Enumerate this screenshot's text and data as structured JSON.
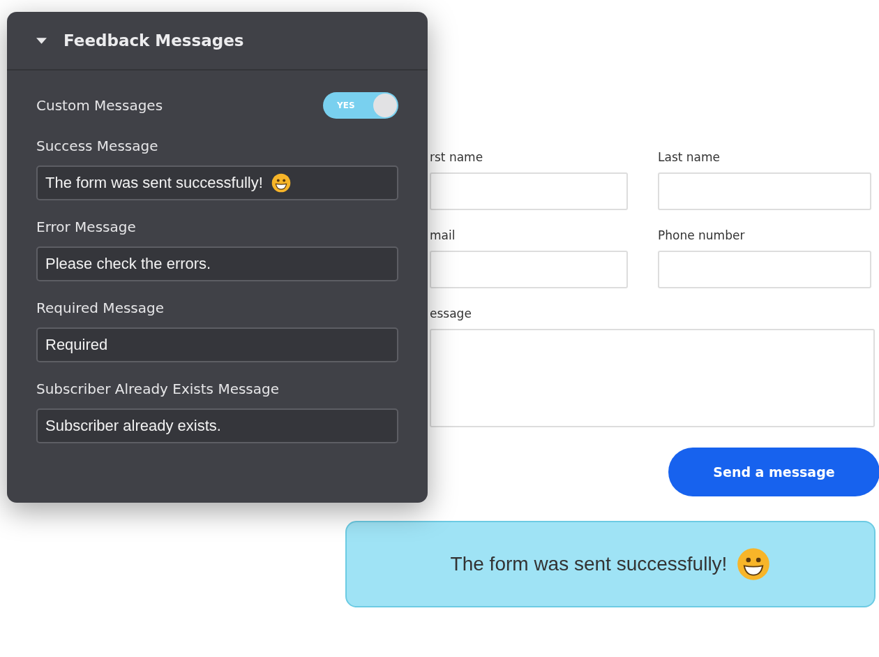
{
  "panel": {
    "title": "Feedback Messages",
    "expanded": true,
    "toggle": {
      "label": "Custom Messages",
      "on": true,
      "text": "YES"
    },
    "fields": [
      {
        "label": "Success Message",
        "value": "The form was sent successfully!",
        "kind": "smiley"
      },
      {
        "label": "Error Message",
        "value": "Please check the errors.",
        "kind": "plain"
      },
      {
        "label": "Required Message",
        "value": "Required",
        "kind": "plain"
      },
      {
        "label": "Subscriber Already Exists Message",
        "value": "Subscriber already exists.",
        "kind": "plain"
      }
    ]
  },
  "form": {
    "fields": [
      {
        "label": "rst name",
        "kind": "line"
      },
      {
        "label": "Last name",
        "kind": "line"
      },
      {
        "label": "mail",
        "kind": "line"
      },
      {
        "label": "Phone number",
        "kind": "line"
      },
      {
        "label": "essage",
        "kind": "area"
      }
    ],
    "button": "Send a message"
  },
  "toast": {
    "text": "The form was sent successfully!",
    "kind": "smiley"
  }
}
